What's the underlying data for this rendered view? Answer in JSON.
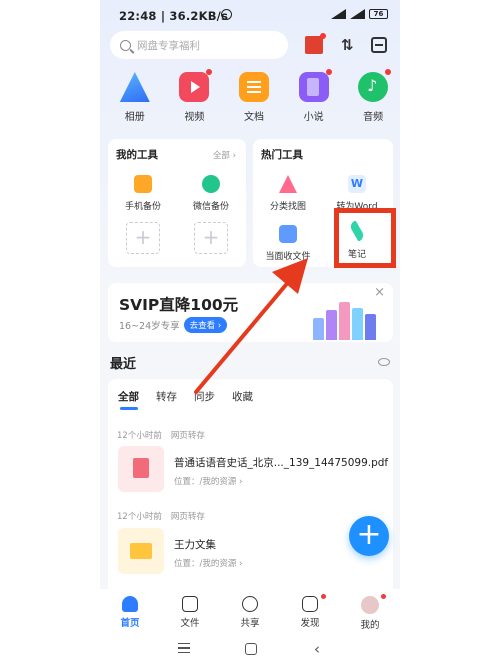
{
  "status": {
    "time": "22:48",
    "speed": "36.2KB/s",
    "battery": "76"
  },
  "search": {
    "placeholder": "网盘专享福利"
  },
  "categories": [
    {
      "label": "相册",
      "icon": "album-icon"
    },
    {
      "label": "视频",
      "icon": "video-icon"
    },
    {
      "label": "文档",
      "icon": "document-icon"
    },
    {
      "label": "小说",
      "icon": "novel-icon"
    },
    {
      "label": "音频",
      "icon": "audio-icon"
    }
  ],
  "my_tools": {
    "title": "我的工具",
    "more": "全部 ›",
    "items": [
      {
        "label": "手机备份"
      },
      {
        "label": "微信备份"
      }
    ]
  },
  "hot_tools": {
    "title": "热门工具",
    "items": [
      {
        "label": "分类找图"
      },
      {
        "label": "转为Word"
      },
      {
        "label": "当面收文件"
      },
      {
        "label": "笔记"
      }
    ]
  },
  "banner": {
    "headline": "SVIP直降100元",
    "subtitle": "16~24岁专享",
    "cta": "去查看 ›",
    "close": "×"
  },
  "recent": {
    "title": "最近",
    "tabs": [
      "全部",
      "转存",
      "同步",
      "收藏"
    ],
    "files": [
      {
        "time": "12个小时前",
        "source": "网页转存",
        "name": "普通话语音史话_北京..._139_14475099.pdf",
        "path": "位置：/我的资源 ›",
        "type": "pdf"
      },
      {
        "time": "12个小时前",
        "source": "网页转存",
        "name": "王力文集",
        "path": "位置：/我的资源 ›",
        "type": "folder"
      }
    ]
  },
  "fab": {
    "label": "+"
  },
  "tabbar": [
    {
      "label": "首页",
      "active": true
    },
    {
      "label": "文件"
    },
    {
      "label": "共享"
    },
    {
      "label": "发现"
    },
    {
      "label": "我的"
    }
  ],
  "colors": {
    "accent": "#2f7dff",
    "annotation_red": "#e63a1e"
  }
}
